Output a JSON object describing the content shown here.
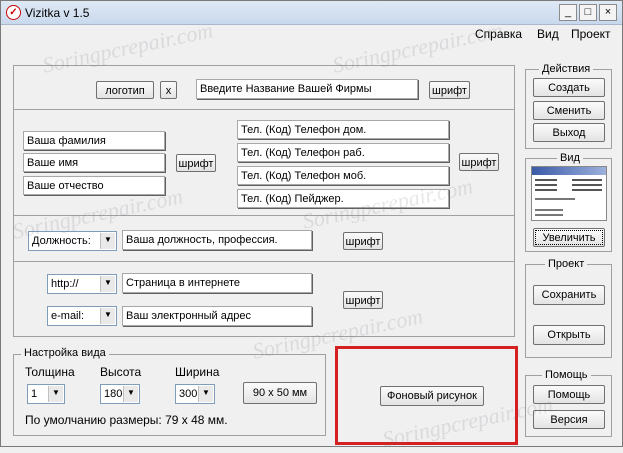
{
  "window": {
    "title": "Vizitka v 1.5",
    "controls": {
      "minimize": "_",
      "maximize": "□",
      "close": "×"
    }
  },
  "menu": [
    "Справка",
    "Вид",
    "Проект"
  ],
  "watermark": "Soringpcrepair.com",
  "top_row": {
    "logo_button": "логотип",
    "remove_logo_button": "x",
    "company_field": "Введите Название Вашей Фирмы",
    "font_button": "шрифт"
  },
  "person": {
    "surname": "Ваша фамилия",
    "name": "Ваше имя",
    "patronymic": "Ваше отчество",
    "font_button": "шрифт"
  },
  "phones": {
    "home": "Тел. (Код) Телефон дом.",
    "work": "Тел. (Код) Телефон раб.",
    "mobile": "Тел. (Код) Телефон моб.",
    "pager": "Тел. (Код) Пейджер.",
    "font_button": "шрифт"
  },
  "position": {
    "select": "Должность:",
    "field": "Ваша должность, профессия.",
    "font_button": "шрифт"
  },
  "web": {
    "url_select": "http://",
    "url_field": "Страница в интернете",
    "email_select": "e-mail:",
    "email_field": "Ваш электронный адрес",
    "font_button": "шрифт"
  },
  "view_settings": {
    "group_label": "Настройка вида",
    "thickness_label": "Толщина",
    "thickness_value": "1",
    "height_label": "Высота",
    "height_value": "180",
    "width_label": "Ширина",
    "width_value": "300",
    "size_button": "90 x 50 мм",
    "default_size_text": "По умолчанию размеры: 79 x 48 мм.",
    "background_button": "Фоновый рисунок"
  },
  "actions": {
    "group_label": "Действия",
    "create": "Создать",
    "change": "Сменить",
    "exit": "Выход"
  },
  "view": {
    "group_label": "Вид",
    "enlarge": "Увеличить"
  },
  "project": {
    "group_label": "Проект",
    "save": "Сохранить",
    "open": "Открыть"
  },
  "help": {
    "group_label": "Помощь",
    "help": "Помощь",
    "version": "Версия"
  },
  "colors": {
    "highlight": "#d42020",
    "window_bg": "#f0f0f0"
  }
}
